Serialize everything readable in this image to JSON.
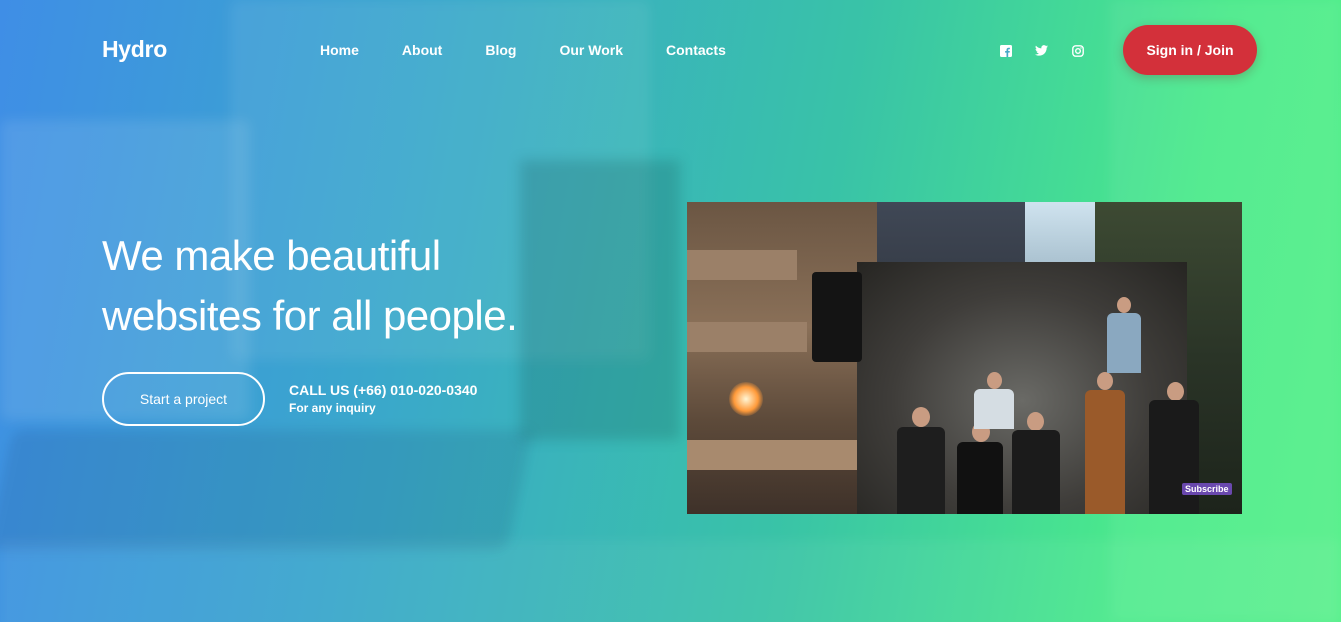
{
  "header": {
    "logo": "Hydro",
    "nav": [
      {
        "label": "Home"
      },
      {
        "label": "About"
      },
      {
        "label": "Blog"
      },
      {
        "label": "Our Work"
      },
      {
        "label": "Contacts"
      }
    ],
    "social": [
      {
        "icon": "facebook-icon"
      },
      {
        "icon": "twitter-icon"
      },
      {
        "icon": "instagram-icon"
      }
    ],
    "signin_label": "Sign in / Join"
  },
  "hero": {
    "headline_line1": "We make beautiful",
    "headline_line2": "websites for all people.",
    "cta_label": "Start a project",
    "call_line1": "CALL US (+66) 010-020-0340",
    "call_line2": "For any inquiry"
  },
  "video": {
    "badge": "Subscribe"
  },
  "colors": {
    "gradient_start": "#3f8ee6",
    "gradient_end": "#55f08a",
    "signin_bg": "#d3303a"
  }
}
